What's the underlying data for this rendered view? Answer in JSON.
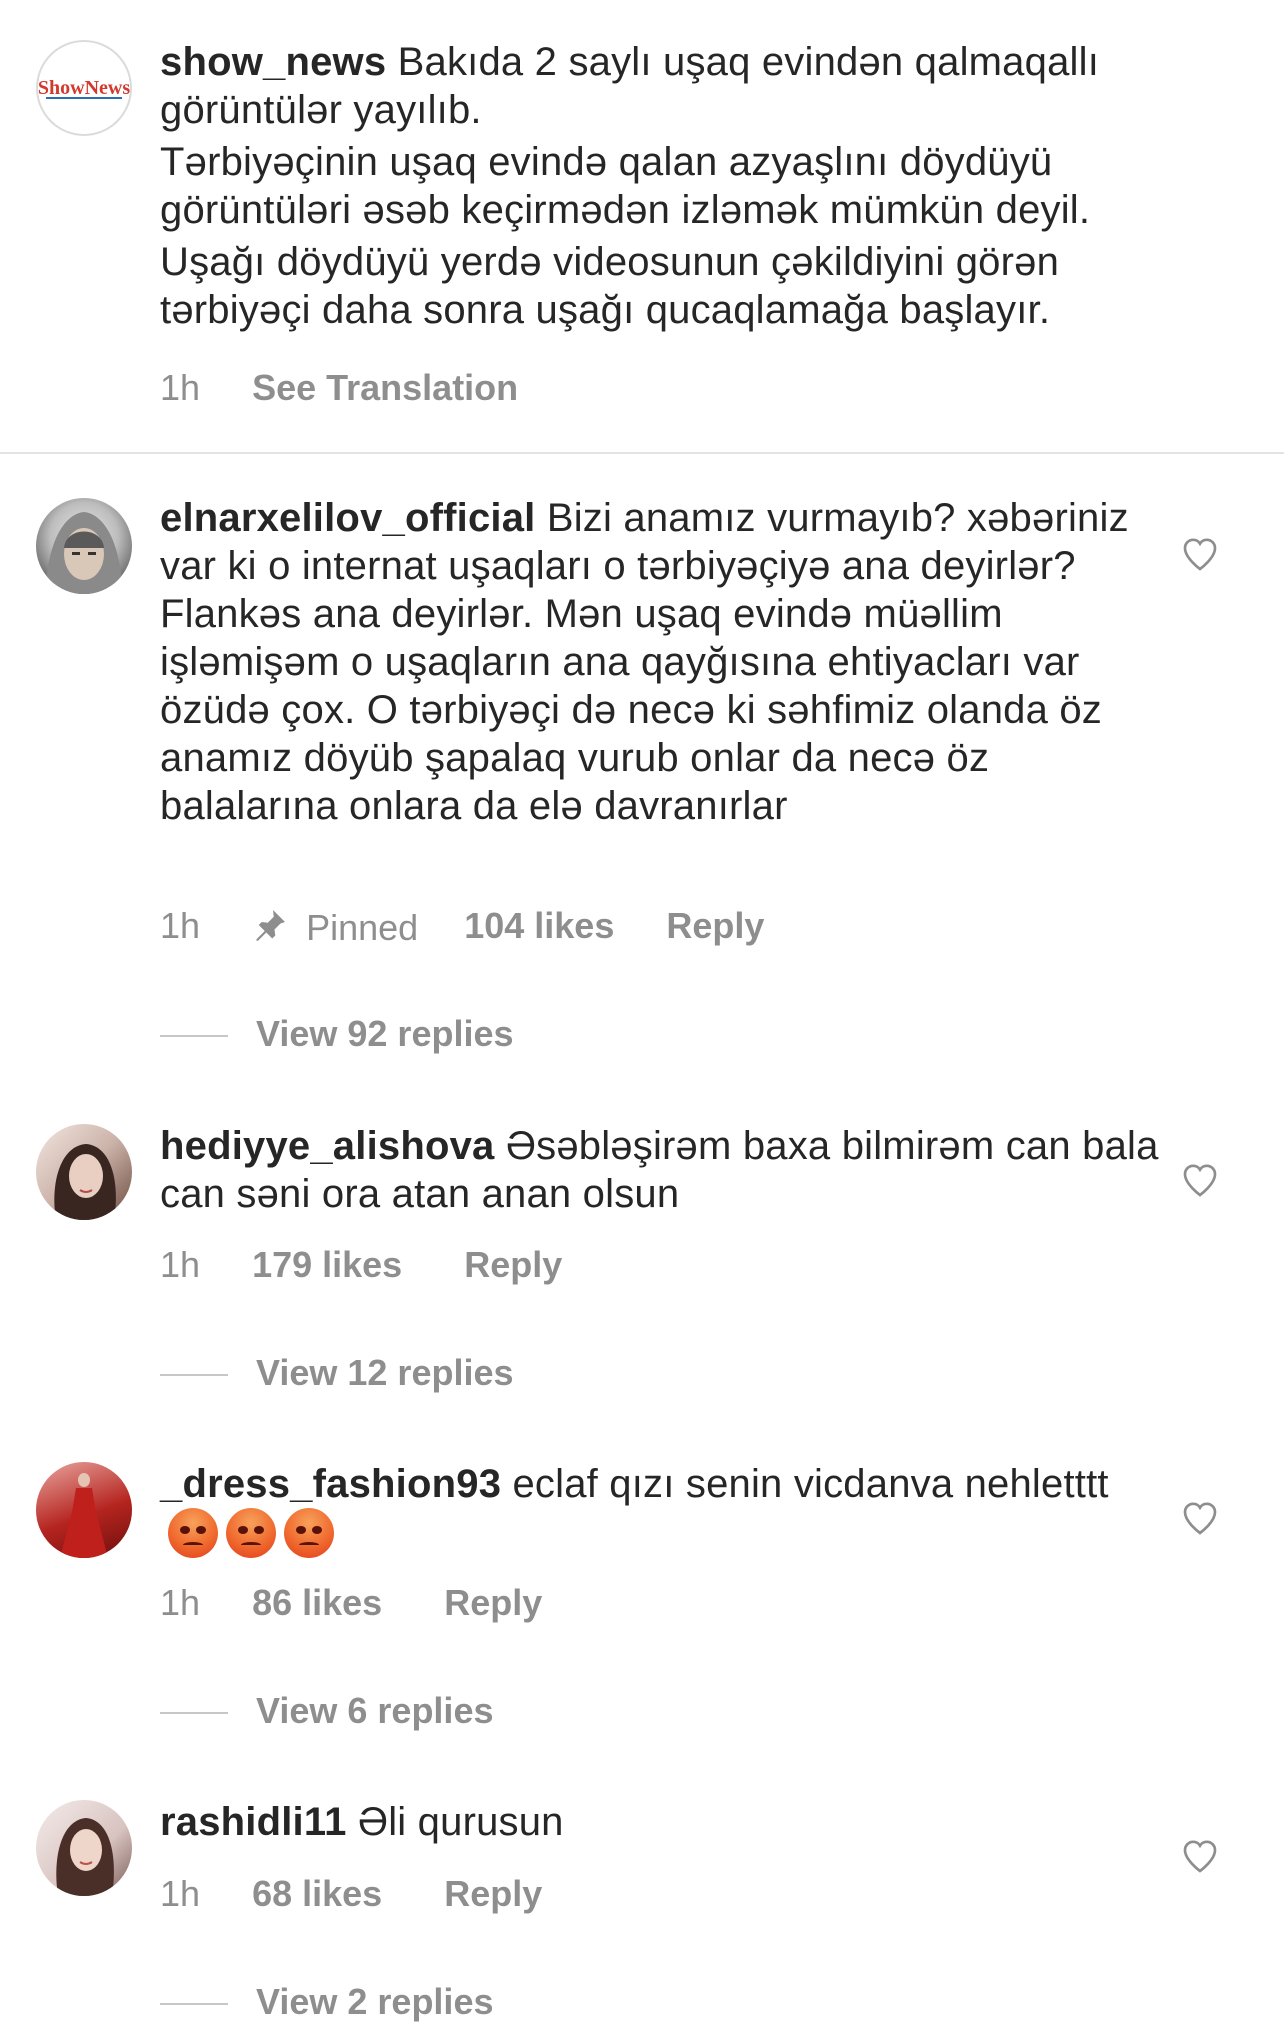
{
  "caption": {
    "username": "show_news",
    "logo_text": "ShowNews",
    "paragraphs": [
      "Bakıda 2 saylı uşaq evindən qalmaqallı görüntülər yayılıb.",
      "Tərbiyəçinin uşaq evində qalan azyaşlını döydüyü görüntüləri əsəb keçirmədən izləmək mümkün deyil.",
      "Uşağı döydüyü yerdə videosunun çəkildiyini görən tərbiyəçi daha sonra uşağı qucaqlamağa başlayır."
    ],
    "time": "1h",
    "translation_label": "See Translation"
  },
  "comments": [
    {
      "username": "elnarxelilov_official",
      "text": "Bizi anamız vurmayıb? xəbəriniz var ki o internat uşaqları o tərbiyəçiyə ana deyirlər? Flankəs ana deyirlər. Mən uşaq evində müəllim işləmişəm o uşaqların ana qayğısına ehtiyacları var özüdə çox. O tərbiyəçi də necə ki səhfimiz olanda öz anamız döyüb şapalaq vurub onlar da necə öz balalarına onlara da elə davranırlar",
      "time": "1h",
      "pinned_label": "Pinned",
      "likes": "104 likes",
      "reply_label": "Reply",
      "view_replies": "View 92 replies"
    },
    {
      "username": "hediyye_alishova",
      "text": "Əsəbləşirəm baxa bilmirəm can bala can səni ora atan anan olsun",
      "time": "1h",
      "likes": "179 likes",
      "reply_label": "Reply",
      "view_replies": "View 12 replies"
    },
    {
      "username": "_dress_fashion93",
      "text": "eclaf qızı senin vicdanva nehletttt",
      "emoji": "pouting-face-emoji",
      "time": "1h",
      "likes": "86 likes",
      "reply_label": "Reply",
      "view_replies": "View 6 replies"
    },
    {
      "username": "rashidli11",
      "text": "Əli qurusun",
      "time": "1h",
      "likes": "68 likes",
      "reply_label": "Reply",
      "view_replies": "View 2 replies"
    }
  ],
  "icons": {
    "like": "heart-outline-icon",
    "pin": "pin-icon"
  },
  "colors": {
    "text": "#262626",
    "secondary": "#8e8e8e",
    "divider": "#e3e3e3"
  }
}
